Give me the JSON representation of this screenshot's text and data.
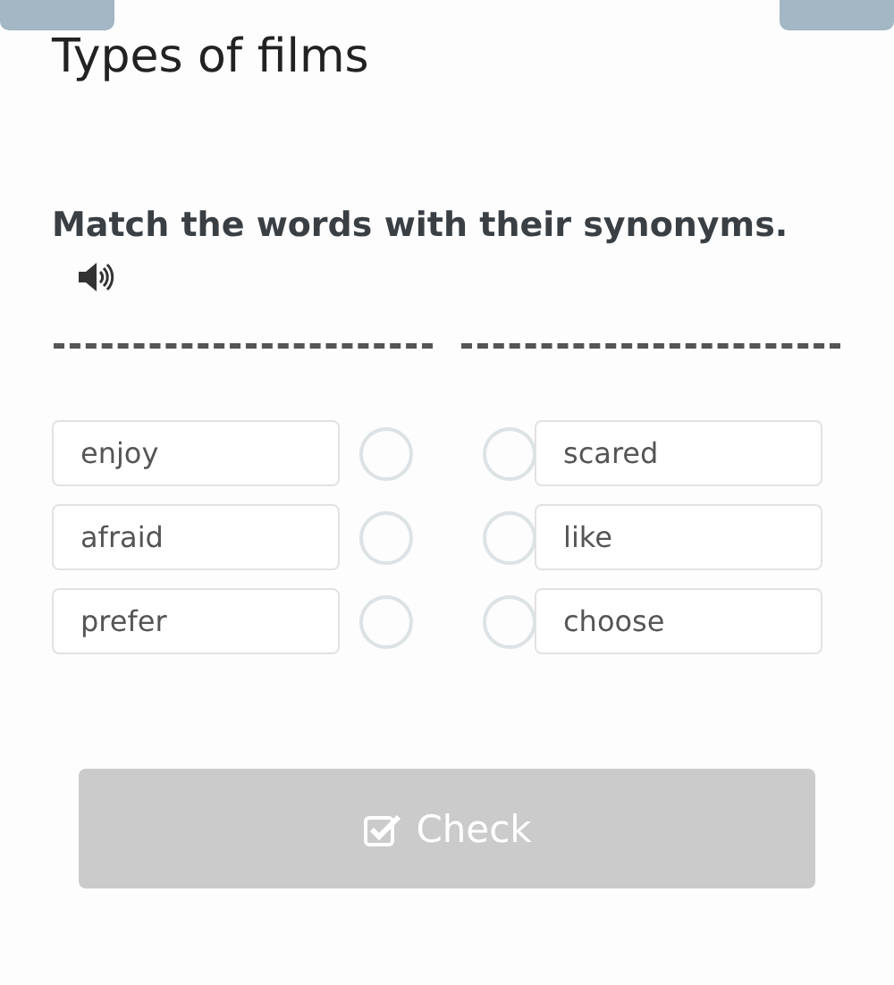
{
  "title": "Types of films",
  "instruction": "Match the words with their synonyms.",
  "left_words": [
    "enjoy",
    "afraid",
    "prefer"
  ],
  "right_words": [
    "scared",
    "like",
    "choose"
  ],
  "check_button": {
    "label": "Check",
    "disabled": true
  }
}
